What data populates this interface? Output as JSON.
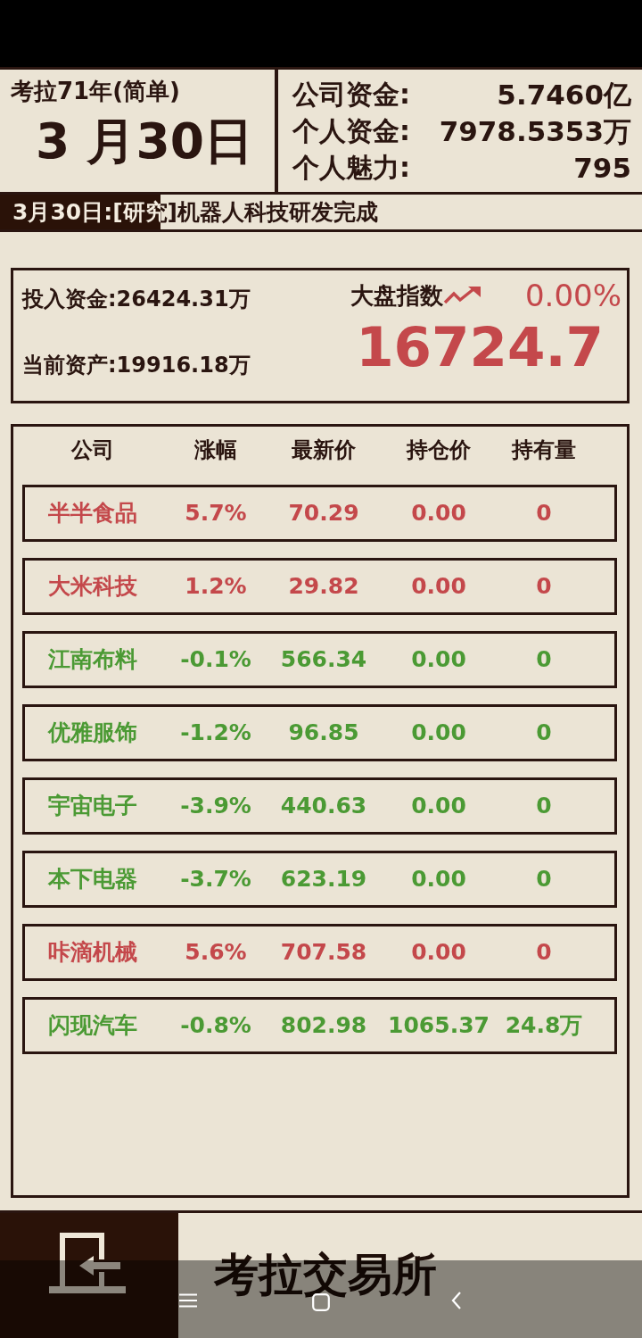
{
  "header": {
    "game_year": "考拉71年(简单)",
    "date": "3 月30日",
    "stats": [
      {
        "label": "公司资金:",
        "value": "5.7460亿"
      },
      {
        "label": "个人资金:",
        "value": "7978.5353万"
      },
      {
        "label": "个人魅力:",
        "value": "795"
      }
    ]
  },
  "news": {
    "text": "3月30日:[研究]机器人科技研发完成"
  },
  "portfolio": {
    "invested": "投入资金:26424.31万",
    "current_assets": "当前资产:19916.18万"
  },
  "index": {
    "label": "大盘指数",
    "rising": true,
    "change": "0.00%",
    "value": "16724.7"
  },
  "stocks": {
    "columns": [
      "公司",
      "涨幅",
      "最新价",
      "持仓价",
      "持有量"
    ],
    "rows": [
      {
        "company": "半半食品",
        "change": "5.7%",
        "price": "70.29",
        "cost": "0.00",
        "holding": "0",
        "color": "#c4484b"
      },
      {
        "company": "大米科技",
        "change": "1.2%",
        "price": "29.82",
        "cost": "0.00",
        "holding": "0",
        "color": "#c4484b"
      },
      {
        "company": "江南布料",
        "change": "-0.1%",
        "price": "566.34",
        "cost": "0.00",
        "holding": "0",
        "color": "#4b9a34"
      },
      {
        "company": "优雅服饰",
        "change": "-1.2%",
        "price": "96.85",
        "cost": "0.00",
        "holding": "0",
        "color": "#4b9a34"
      },
      {
        "company": "宇宙电子",
        "change": "-3.9%",
        "price": "440.63",
        "cost": "0.00",
        "holding": "0",
        "color": "#4b9a34"
      },
      {
        "company": "本下电器",
        "change": "-3.7%",
        "price": "623.19",
        "cost": "0.00",
        "holding": "0",
        "color": "#4b9a34"
      },
      {
        "company": "咔滴机械",
        "change": "5.6%",
        "price": "707.58",
        "cost": "0.00",
        "holding": "0",
        "color": "#c4484b"
      },
      {
        "company": "闪现汽车",
        "change": "-0.8%",
        "price": "802.98",
        "cost": "1065.37",
        "holding": "24.8万",
        "color": "#4b9a34"
      }
    ]
  },
  "footer": {
    "title": "考拉交易所"
  }
}
